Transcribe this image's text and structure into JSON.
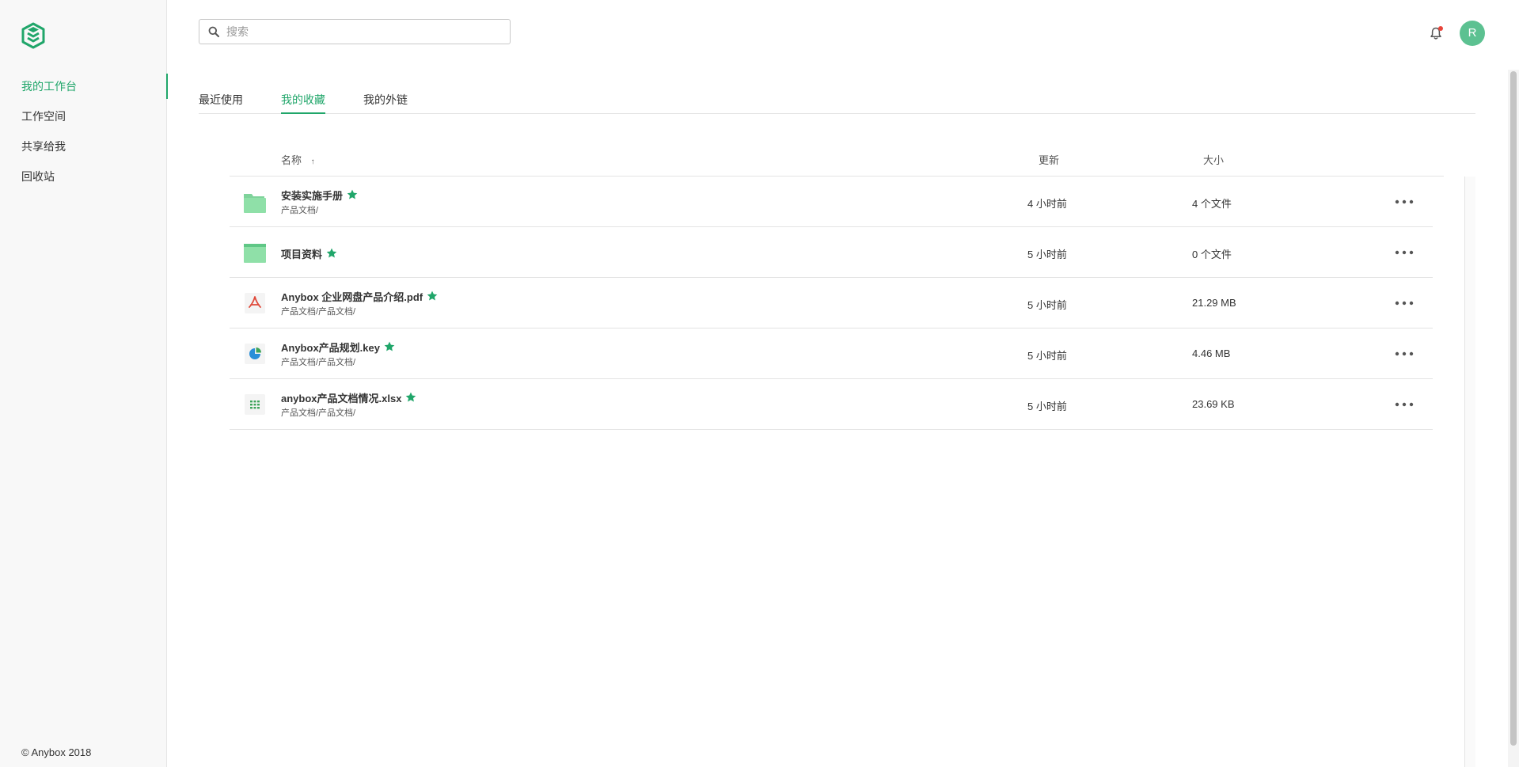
{
  "sidebar": {
    "items": [
      {
        "label": "我的工作台",
        "active": true
      },
      {
        "label": "工作空间",
        "active": false
      },
      {
        "label": "共享给我",
        "active": false
      },
      {
        "label": "回收站",
        "active": false
      }
    ],
    "copyright": "© Anybox 2018"
  },
  "header": {
    "search_placeholder": "搜索",
    "search_value": "",
    "avatar_initial": "R"
  },
  "tabs": [
    {
      "label": "最近使用",
      "active": false
    },
    {
      "label": "我的收藏",
      "active": true
    },
    {
      "label": "我的外链",
      "active": false
    }
  ],
  "table": {
    "columns": {
      "name": "名称",
      "updated": "更新",
      "size": "大小"
    },
    "sort_icon": "↑",
    "rows": [
      {
        "name": "安装实施手册",
        "path": "产品文档/",
        "updated": "4 小时前",
        "size": "4 个文件",
        "type": "folder",
        "starred": true
      },
      {
        "name": "项目资料",
        "path": "",
        "updated": "5 小时前",
        "size": "0 个文件",
        "type": "folder-closed",
        "starred": true
      },
      {
        "name": "Anybox 企业网盘产品介绍.pdf",
        "path": "产品文档/产品文档/",
        "updated": "5 小时前",
        "size": "21.29 MB",
        "type": "pdf",
        "starred": true
      },
      {
        "name": "Anybox产品规划.key",
        "path": "产品文档/产品文档/",
        "updated": "5 小时前",
        "size": "4.46 MB",
        "type": "keynote",
        "starred": true
      },
      {
        "name": "anybox产品文档情况.xlsx",
        "path": "产品文档/产品文档/",
        "updated": "5 小时前",
        "size": "23.69 KB",
        "type": "spreadsheet",
        "starred": true
      }
    ]
  },
  "colors": {
    "accent": "#20a66a",
    "avatar": "#5cc191",
    "folder": "#8fe0a8",
    "pdf": "#e0493a",
    "keynote": "#2a8fd8",
    "spreadsheet": "#3ea45a",
    "notification_dot": "#e8443a"
  },
  "icons": {
    "logo": "anybox-logo-icon",
    "search": "search-icon",
    "bell": "bell-icon",
    "star": "star-icon",
    "more": "more-horizontal-icon"
  }
}
